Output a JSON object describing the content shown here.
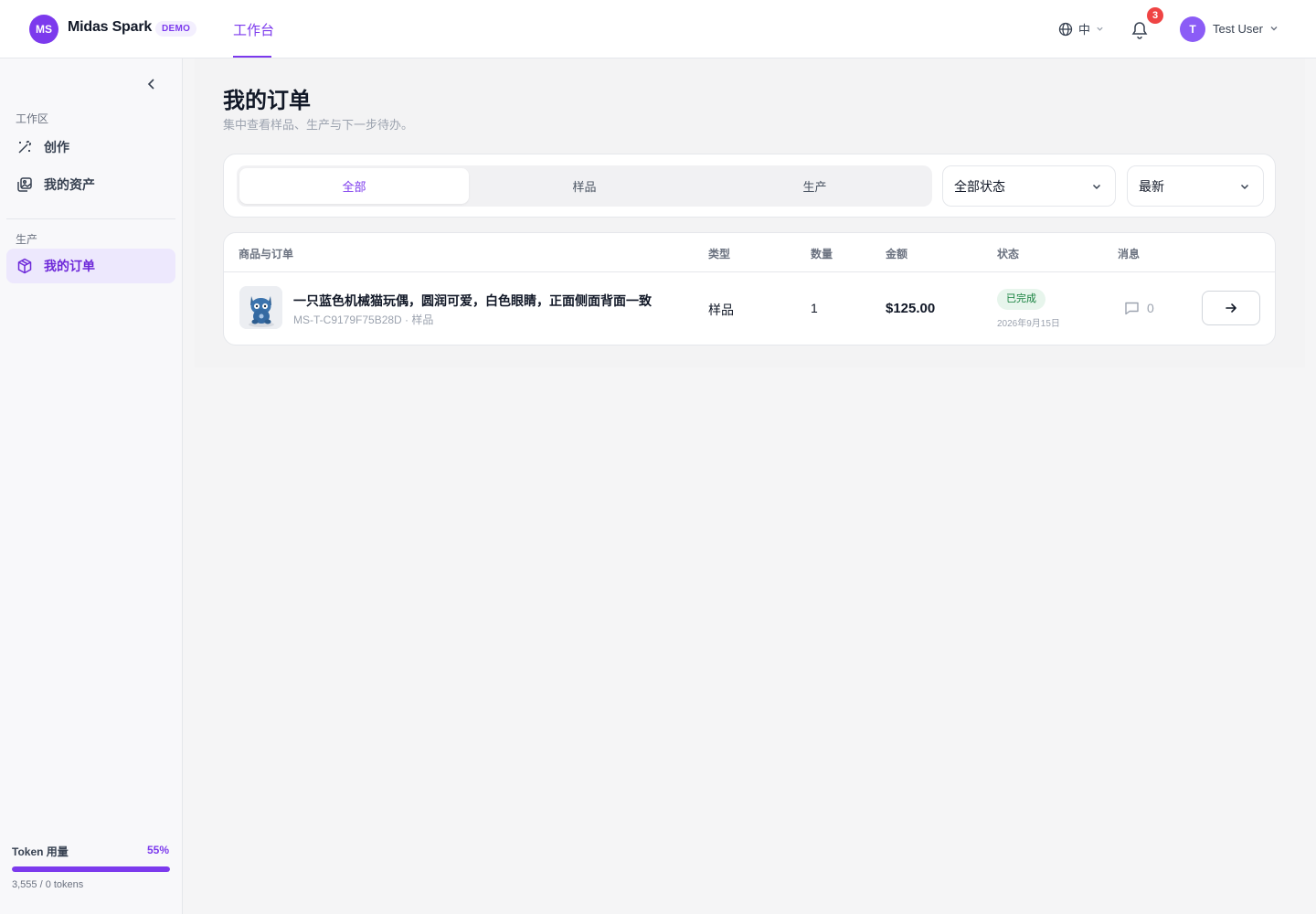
{
  "header": {
    "logo_initials": "MS",
    "brand": "Midas Spark",
    "badge": "DEMO",
    "nav_tab": "工作台",
    "language": "中",
    "notification_count": "3",
    "user_initial": "T",
    "user_name": "Test User"
  },
  "sidebar": {
    "workspace_label": "工作区",
    "workspace_items": [
      {
        "label": "创作",
        "icon": "magic-wand-icon"
      },
      {
        "label": "我的资产",
        "icon": "images-icon"
      }
    ],
    "production_label": "生产",
    "production_items": [
      {
        "label": "我的订单",
        "icon": "box-icon",
        "active": true
      }
    ],
    "token": {
      "label": "Token 用量",
      "percent_text": "55%",
      "percent": 100,
      "count_text": "3,555 / 0 tokens"
    }
  },
  "main": {
    "title": "我的订单",
    "subtitle": "集中查看样品、生产与下一步待办。",
    "tabs": [
      "全部",
      "样品",
      "生产"
    ],
    "active_tab": 0,
    "status_filter": "全部状态",
    "sort_filter": "最新",
    "table": {
      "headers": [
        "商品与订单",
        "类型",
        "数量",
        "金额",
        "状态",
        "消息"
      ],
      "rows": [
        {
          "name": "一只蓝色机械猫玩偶，圆润可爱，白色眼睛，正面侧面背面一致",
          "meta": "MS-T-C9179F75B28D · 样品",
          "type": "样品",
          "quantity": "1",
          "amount": "$125.00",
          "status": "已完成",
          "date": "2026年9月15日",
          "messages": "0"
        }
      ]
    }
  },
  "colors": {
    "accent": "#7c3aed",
    "status_done_bg": "#e7f5ec",
    "status_done_text": "#15803d",
    "notification": "#ef4444"
  }
}
